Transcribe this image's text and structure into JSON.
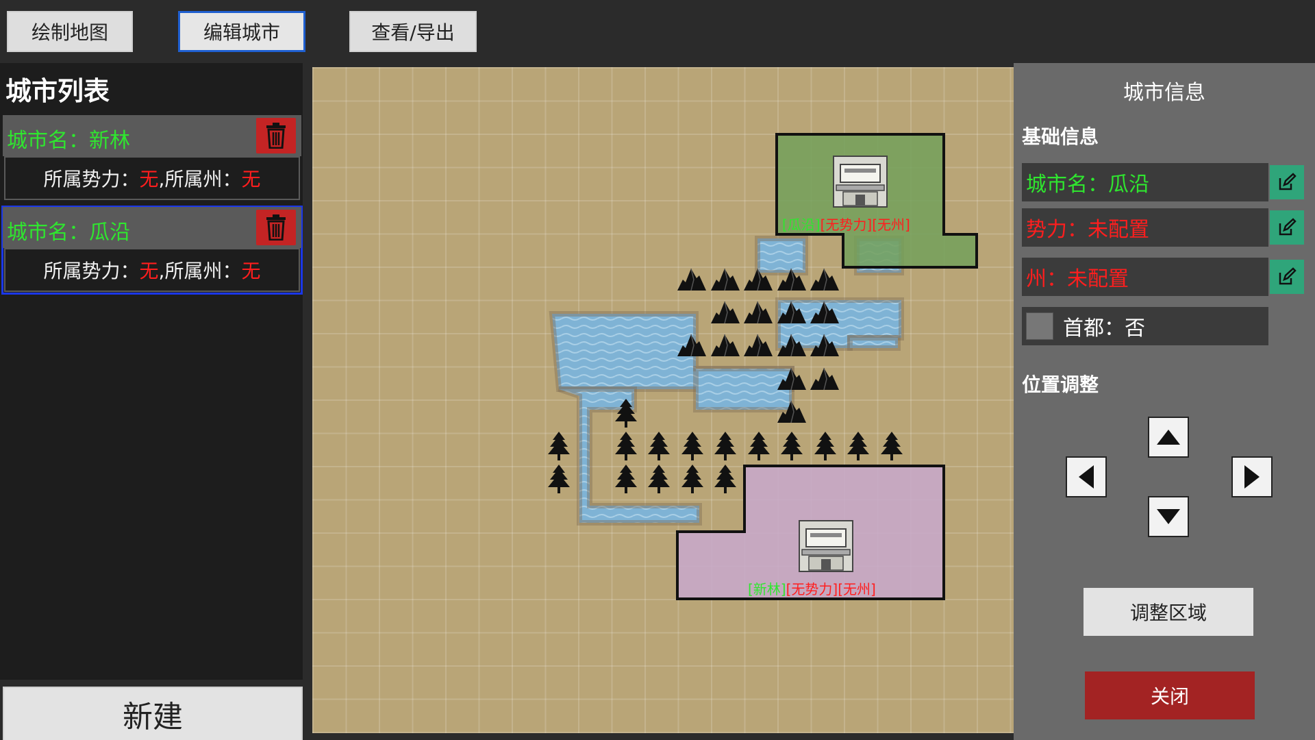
{
  "toolbar": {
    "tabs": [
      {
        "label": "绘制地图"
      },
      {
        "label": "编辑城市"
      },
      {
        "label": "查看/导出"
      }
    ]
  },
  "city_list": {
    "title": "城市列表",
    "items": [
      {
        "name": "城市名：新林",
        "faction_label": "所属势力：",
        "faction_value": "无",
        "state_label": ",所属州：",
        "state_value": "无"
      },
      {
        "name": "城市名：瓜沿",
        "faction_label": "所属势力：",
        "faction_value": "无",
        "state_label": ",所属州：",
        "state_value": "无"
      }
    ],
    "new_label": "新建"
  },
  "map": {
    "cities": [
      {
        "name": "[瓜沿]",
        "faction": "[无势力]",
        "state": "[无州]",
        "region_color": "#73a05a"
      },
      {
        "name": "[新林]",
        "faction": "[无势力]",
        "state": "[无州]",
        "region_color": "#c8a8c8"
      }
    ],
    "water_color": "#7fb3d5",
    "icons": [
      "city-building-icon",
      "mountain-icon",
      "tree-icon"
    ]
  },
  "city_info": {
    "title": "城市信息",
    "basic_section": "基础信息",
    "name_row": "城市名：瓜沿",
    "faction_row": "势力：未配置",
    "state_row": "州：未配置",
    "capital_row": "首都：否",
    "position_section": "位置调整",
    "adjust_label": "调整区域",
    "close_label": "关闭"
  },
  "colors": {
    "accent_blue": "#1f5fd0",
    "delete_red": "#c42424",
    "edit_green": "#2fa57a",
    "text_green": "#2fe62f",
    "text_red": "#ff1e1e"
  }
}
